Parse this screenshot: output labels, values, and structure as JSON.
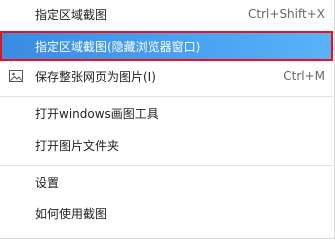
{
  "menu": {
    "items": [
      {
        "label": "指定区域截图",
        "shortcut": "Ctrl+Shift+X"
      },
      {
        "label": "指定区域截图(隐藏浏览器窗口)",
        "shortcut": ""
      },
      {
        "label": "保存整张网页为图片(I)",
        "shortcut": "Ctrl+M",
        "icon": "image-icon"
      },
      {
        "label": "打开windows画图工具",
        "shortcut": ""
      },
      {
        "label": "打开图片文件夹",
        "shortcut": ""
      },
      {
        "label": "设置",
        "shortcut": ""
      },
      {
        "label": "如何使用截图",
        "shortcut": ""
      }
    ],
    "highlight_color": "#3d91e4",
    "focus_border_color": "#e8121a"
  }
}
